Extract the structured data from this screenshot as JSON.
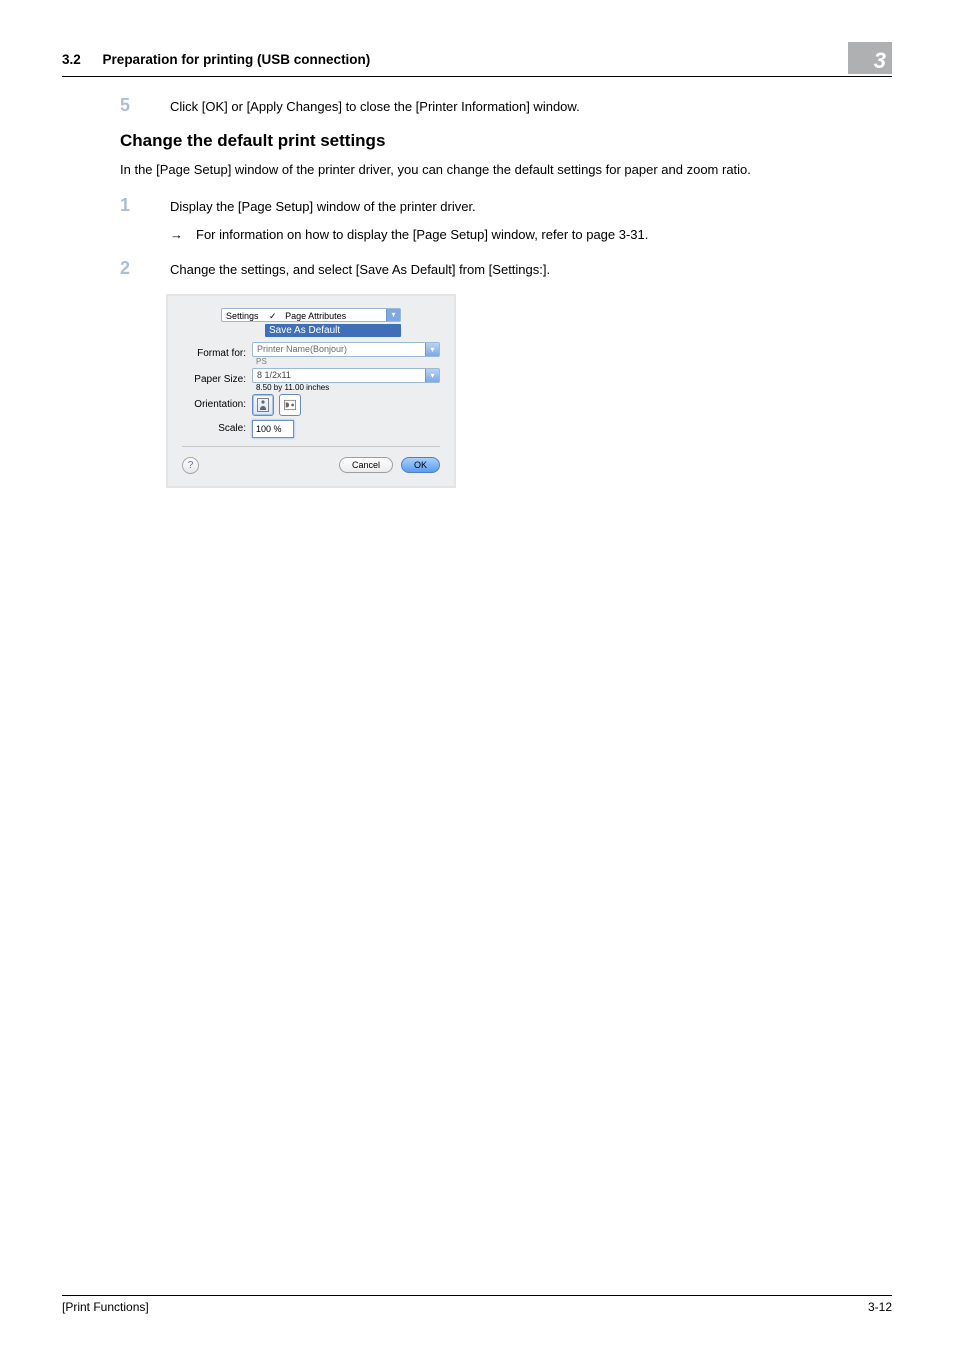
{
  "header": {
    "section_num": "3.2",
    "section_title": "Preparation for printing (USB connection)",
    "chapter_badge": "3"
  },
  "step5": {
    "num": "5",
    "text": "Click [OK] or [Apply Changes] to close the [Printer Information] window."
  },
  "heading2": "Change the default print settings",
  "intro": "In the [Page Setup] window of the printer driver, you can change the default settings for paper and zoom ratio.",
  "step1": {
    "num": "1",
    "text": "Display the [Page Setup] window of the printer driver.",
    "sub_arrow": "→",
    "sub_text": "For information on how to display the [Page Setup] window, refer to page 3-31."
  },
  "step2": {
    "num": "2",
    "text": "Change the settings, and select [Save As Default] from [Settings:]."
  },
  "dialog": {
    "settings_label": "Settings",
    "settings_value": "Page Attributes",
    "save_as_default": "Save As Default",
    "format_for_label": "Format for:",
    "format_for_value": "Printer Name(Bonjour)",
    "format_for_sub": "PS",
    "paper_size_label": "Paper Size:",
    "paper_size_value": "8 1/2x11",
    "paper_size_sub": "8.50 by 11.00 inches",
    "orientation_label": "Orientation:",
    "scale_label": "Scale:",
    "scale_value": "100 %",
    "help": "?",
    "cancel": "Cancel",
    "ok": "OK"
  },
  "footer": {
    "left": "[Print Functions]",
    "right": "3-12"
  }
}
